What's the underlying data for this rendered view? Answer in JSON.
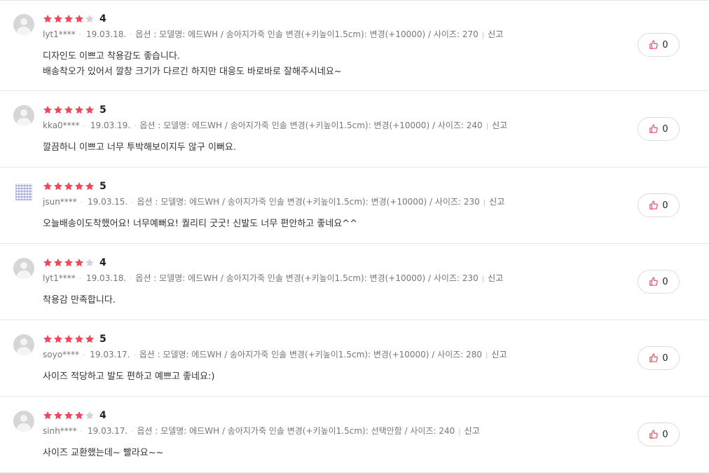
{
  "colors": {
    "star": "#f0475b",
    "star_empty": "#d3d3d3",
    "thumb": "#f0475b"
  },
  "reviews": [
    {
      "rating": 4,
      "rating_label": "4",
      "user": "lyt1****",
      "date": "19.03.18.",
      "option": "옵션 : 모델명: 에드WH / 송아지가죽 인솔 변경(+키높이1.5cm): 변경(+10000) / 사이즈: 270",
      "report": "신고",
      "avatar": "default",
      "lines": [
        "디자인도 이쁘고 착용감도 좋습니다.",
        "배송착오가 있어서 깔창 크기가 다르긴 하지만 대응도 바로바로 잘해주시네요~"
      ],
      "likes": "0"
    },
    {
      "rating": 5,
      "rating_label": "5",
      "user": "kka0****",
      "date": "19.03.19.",
      "option": "옵션 : 모델명: 에드WH / 송아지가죽 인솔 변경(+키높이1.5cm): 변경(+10000) / 사이즈: 240",
      "report": "신고",
      "avatar": "default",
      "lines": [
        "깔끔하니 이쁘고 너무 투박해보이지두 않구 이뻐요."
      ],
      "likes": "0"
    },
    {
      "rating": 5,
      "rating_label": "5",
      "user": "jsun****",
      "date": "19.03.15.",
      "option": "옵션 : 모델명: 에드WH / 송아지가죽 인솔 변경(+키높이1.5cm): 변경(+10000) / 사이즈: 230",
      "report": "신고",
      "avatar": "pattern",
      "lines": [
        "오늘배송이도착했어요! 너무예뻐요! 퀄리티 굿굿! 신발도 너무 편안하고 좋네요^^"
      ],
      "likes": "0"
    },
    {
      "rating": 4,
      "rating_label": "4",
      "user": "lyt1****",
      "date": "19.03.18.",
      "option": "옵션 : 모델명: 에드WH / 송아지가죽 인솔 변경(+키높이1.5cm): 변경(+10000) / 사이즈: 230",
      "report": "신고",
      "avatar": "default",
      "lines": [
        "착용감 만족합니다."
      ],
      "likes": "0"
    },
    {
      "rating": 5,
      "rating_label": "5",
      "user": "soyo****",
      "date": "19.03.17.",
      "option": "옵션 : 모델명: 에드WH / 송아지가죽 인솔 변경(+키높이1.5cm): 변경(+10000) / 사이즈: 280",
      "report": "신고",
      "avatar": "default",
      "lines": [
        "사이즈 적당하고 발도 편하고 예쁘고 좋네요:)"
      ],
      "likes": "0"
    },
    {
      "rating": 4,
      "rating_label": "4",
      "user": "sinh****",
      "date": "19.03.17.",
      "option": "옵션 : 모델명: 에드WH / 송아지가죽 인솔 변경(+키높이1.5cm): 선택안함 / 사이즈: 240",
      "report": "신고",
      "avatar": "default",
      "lines": [
        "사이즈 교환했는데~ 빨라요~~"
      ],
      "likes": "0"
    }
  ]
}
